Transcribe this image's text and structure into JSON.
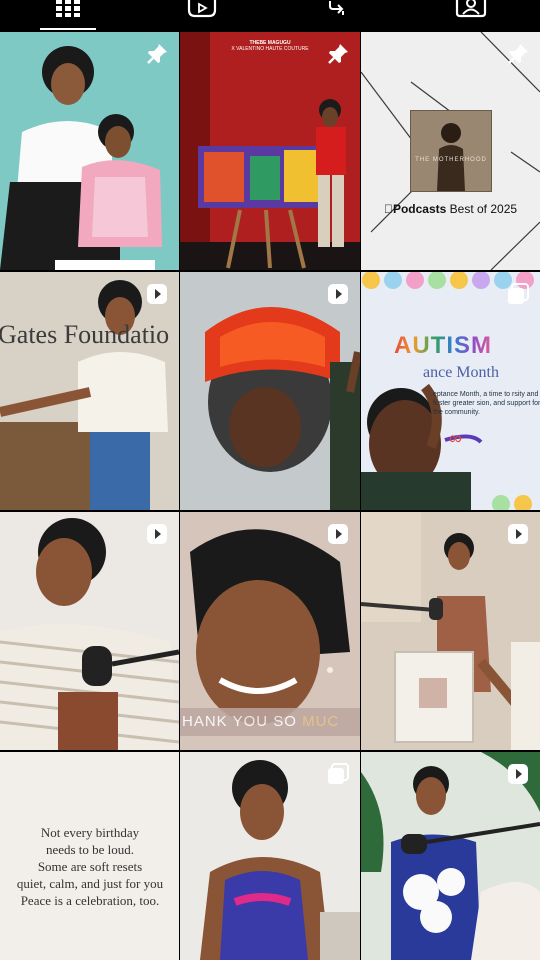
{
  "tabs": [
    {
      "name": "grid",
      "icon": "grid-icon",
      "active": true
    },
    {
      "name": "reels",
      "icon": "reels-icon",
      "active": false
    },
    {
      "name": "reposts",
      "icon": "repost-icon",
      "active": false
    },
    {
      "name": "tagged",
      "icon": "tagged-user-icon",
      "active": false
    }
  ],
  "posts": [
    {
      "type": "pinned",
      "badge": "pin-icon"
    },
    {
      "type": "pinned",
      "badge": "pin-icon",
      "caption_title": "THEBE MAGUGU",
      "caption_sub": "X VALENTINO HAUTE COUTURE"
    },
    {
      "type": "pinned",
      "badge": "pin-icon",
      "cover_title": "THE MOTHERHOOD",
      "label_brand": "Podcasts",
      "label_rest": "Best of 2025"
    },
    {
      "type": "reel",
      "badge": "reel-icon",
      "wall_text": "Gates Foundatio"
    },
    {
      "type": "reel",
      "badge": "reel-icon"
    },
    {
      "type": "carousel",
      "badge": "carousel-icon",
      "title": "AUTISM",
      "subtitle": "ance Month",
      "body": "eptance Month, a time to rsity and foster greater sion, and support for the community."
    },
    {
      "type": "reel",
      "badge": "reel-icon"
    },
    {
      "type": "reel",
      "badge": "reel-icon",
      "subtitle_a": "HANK YOU SO ",
      "subtitle_b": "MUC"
    },
    {
      "type": "reel",
      "badge": "reel-icon"
    },
    {
      "type": "photo",
      "badge": "",
      "quote": [
        "Not every birthday",
        "needs to be loud.",
        "Some are soft resets",
        "quiet, calm, and just for you",
        "Peace is a celebration, too."
      ]
    },
    {
      "type": "carousel",
      "badge": "carousel-icon"
    },
    {
      "type": "reel",
      "badge": "reel-icon"
    }
  ],
  "colors": {
    "background": "#000000",
    "icon": "#ffffff",
    "autism_letters": [
      "#e24b3c",
      "#f29a2e",
      "#3aa35b",
      "#2f7fd0",
      "#8a4fc5",
      "#e05a9a"
    ]
  }
}
